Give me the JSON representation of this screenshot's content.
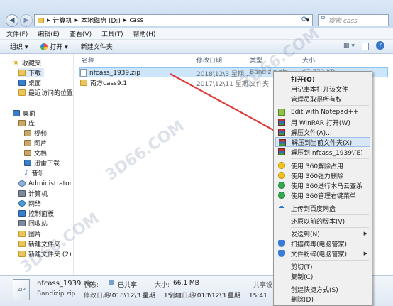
{
  "address": {
    "segments": [
      "计算机",
      "本地磁盘 (D:)",
      "cass"
    ],
    "search_placeholder": "搜索 cass"
  },
  "menubar": [
    "文件(F)",
    "编辑(E)",
    "查看(V)",
    "工具(T)",
    "帮助(H)"
  ],
  "toolbar": {
    "organize": "组织 ▾",
    "open": "打开 ▾",
    "new_folder": "新建文件夹"
  },
  "nav": {
    "favorites": "收藏夹",
    "downloads": "下载",
    "desktop_fav": "桌面",
    "recent": "最近访问的位置",
    "desktop": "桌面",
    "library": "库",
    "videos": "视频",
    "pictures": "图片",
    "documents": "文档",
    "xunlei": "迅雷下载",
    "music": "音乐",
    "admin": "Administrator",
    "computer": "计算机",
    "network": "网络",
    "control_panel": "控制面板",
    "recycle": "回收站",
    "pictures2": "图片",
    "newfolder": "新建文件夹",
    "newfolder2": "新建文件夹 (2)"
  },
  "columns": {
    "name": "名称",
    "modified": "修改日期",
    "type": "类型",
    "size": "大小"
  },
  "files": [
    {
      "name": "nfcass_1939.zip",
      "modified": "2018\\12\\3 星期...",
      "type": "Bandizip.zip",
      "size": "67,772 KB"
    },
    {
      "name": "南方cass9.1",
      "modified": "2017\\12\\11 星期...",
      "type": "文件夹",
      "size": ""
    }
  ],
  "status": {
    "filename": "nfcass_1939.zip",
    "state_label": "状态:",
    "state_value": "已共享",
    "size_label": "大小:",
    "size_value": "66.1 MB",
    "app": "Bandizip.zip",
    "modified_label": "修改日期:",
    "modified_value": "2018\\12\\3 星期一 15:41",
    "created_label": "创建日期:",
    "created_value": "2018\\12\\3 星期一 15:41",
    "shared_label": "共享设"
  },
  "context_menu": {
    "open": "打开(O)",
    "notepad_open": "用记事本打开该文件",
    "admin_own": "管理员取得所有权",
    "notepadpp": "Edit with Notepad++",
    "winrar": "用 WinRAR 打开(W)",
    "extract_files": "解压文件(A)...",
    "extract_here": "解压到当前文件夹(X)",
    "extract_to": "解压到 nfcass_1939\\(E)",
    "unlock360": "使用 360解除占用",
    "delete360": "使用 360强力删除",
    "scan360": "使用 360进行木马云查杀",
    "menu360": "使用 360管理右键菜单",
    "baidu": "上传到百度网盘",
    "restore": "还原以前的版本(V)",
    "sendto": "发送到(N)",
    "scanvirus": "扫描病毒(电脑管家)",
    "shred": "文件粉碎(电脑管家)",
    "cut": "剪切(T)",
    "copy": "复制(C)",
    "shortcut": "创建快捷方式(S)",
    "delete": "删除(D)"
  },
  "colors": {
    "arrow": "#e03b3b",
    "selection": "#cde6fb",
    "highlight": "#d8e6f6"
  }
}
